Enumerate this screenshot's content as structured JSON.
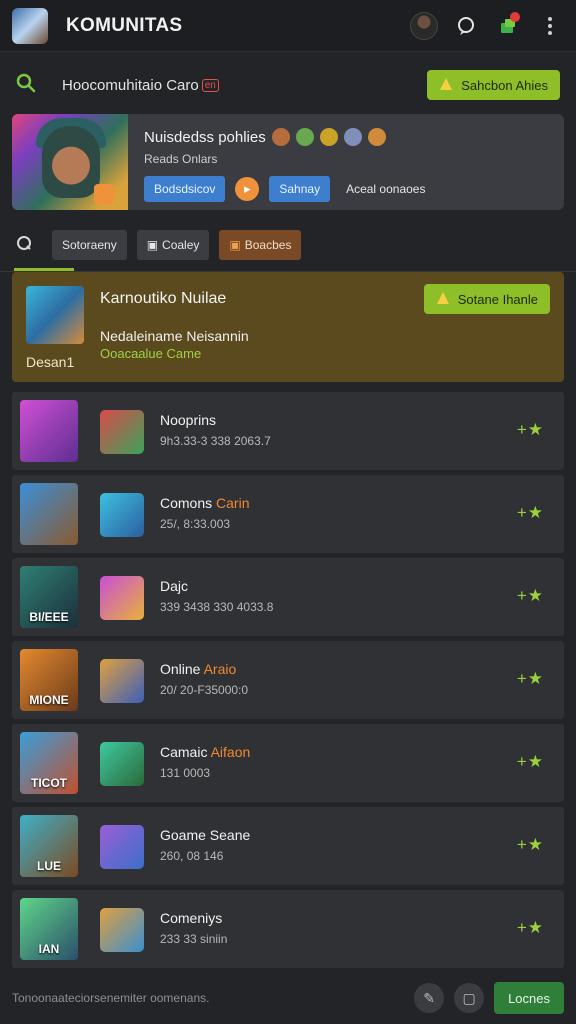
{
  "header": {
    "title": "KOMUNITAS",
    "logo_icon": "app-logo-icon",
    "icons": [
      "user-avatar",
      "chat-bubble-icon",
      "notifications-icon",
      "kebab-menu-icon"
    ]
  },
  "search": {
    "text": "Hoocomuhitaio Caro",
    "tag": "en",
    "button_label": "Sahcbon Ahies"
  },
  "profile": {
    "title": "Nuisdedss pohlies",
    "subtitle": "Reads Onlars",
    "primary_button": "Bodsdsicov",
    "secondary_button": "Sahnay",
    "link": "Aceal oonaoes"
  },
  "chips": [
    "Sotoraeny",
    "Coaley",
    "Boacbes"
  ],
  "featured": {
    "label": "Desan1",
    "title": "Karnoutiko Nuilae",
    "subtitle": "Nedaleiname Neisannin",
    "highlight": "Ooacaalue Came",
    "button_label": "Sotane Ihanle"
  },
  "games": [
    {
      "thumb_label": "",
      "name": "Nooprins",
      "accent": "",
      "meta": "9h3.33-3 338 2063.7"
    },
    {
      "thumb_label": "",
      "name": "Comons",
      "accent": "Carin",
      "meta": "25/, 8:33.003"
    },
    {
      "thumb_label": "BI/EEE",
      "name": "Dajc",
      "accent": "",
      "meta": "339 3438 330 4033.8"
    },
    {
      "thumb_label": "MIONE",
      "name": "Online",
      "accent": "Araio",
      "meta": "20/ 20-F35000:0"
    },
    {
      "thumb_label": "TICOT",
      "name": "Camaic",
      "accent": "Aifaon",
      "meta": "131 0003"
    },
    {
      "thumb_label": "LUE",
      "name": "Goame Seane",
      "accent": "",
      "meta": "260, 08 146"
    },
    {
      "thumb_label": "IAN",
      "name": "Comeniys",
      "accent": "",
      "meta": "233 33 siniin"
    }
  ],
  "footer": {
    "text": "Tonoonaateciorsenemiter oomenans.",
    "button_label": "Locnes"
  },
  "colors": {
    "accent_green": "#8fbf28",
    "accent_orange": "#ef8a2e",
    "featured_bg": "#5a4a1e",
    "blue": "#3d7fce"
  }
}
